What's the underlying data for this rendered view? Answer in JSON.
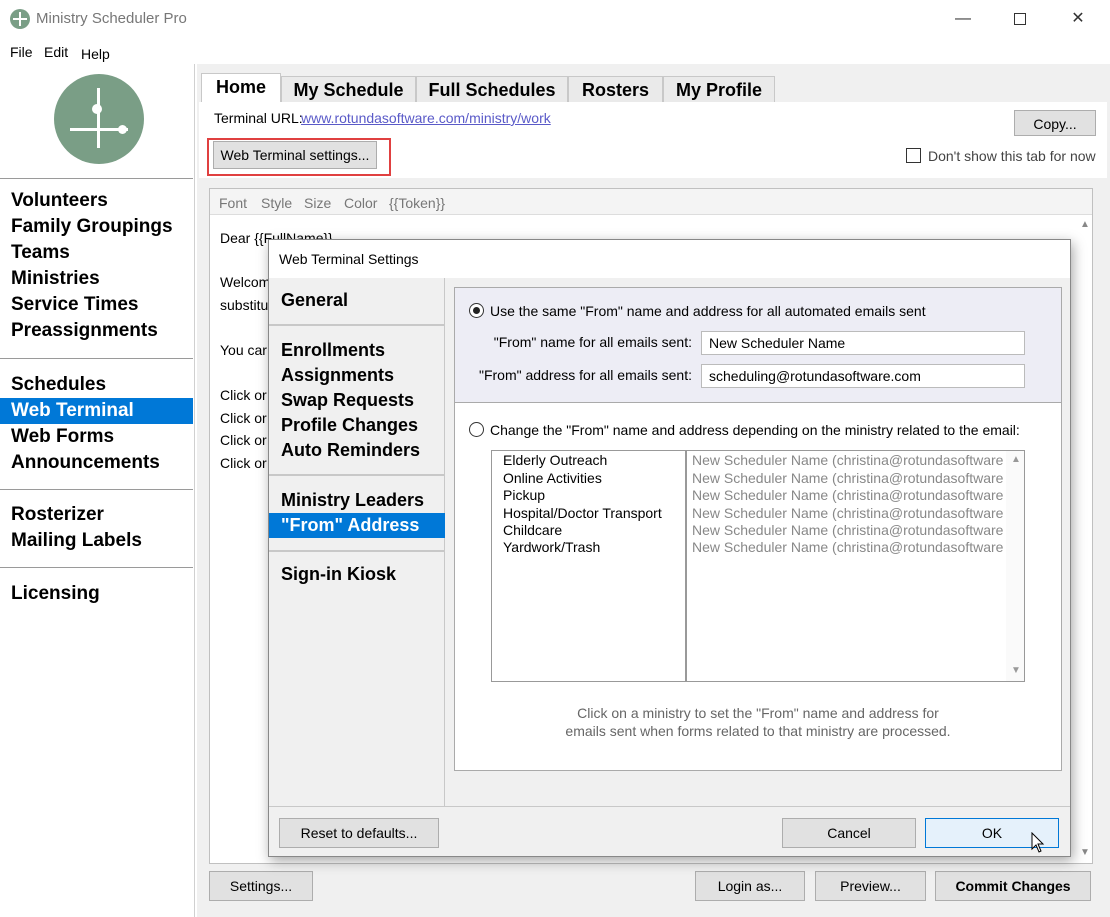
{
  "window": {
    "title": "Ministry Scheduler Pro",
    "minimize_glyph": "—",
    "close_glyph": "✕"
  },
  "menu": [
    "File",
    "Edit",
    "Help"
  ],
  "sidebar": {
    "groups": [
      [
        "Volunteers",
        "Family Groupings",
        "Teams",
        "Ministries",
        "Service Times",
        "Preassignments"
      ],
      [
        "Schedules",
        "Web Terminal",
        "Web Forms",
        "Announcements"
      ],
      [
        "Rosterizer",
        "Mailing Labels"
      ],
      [
        "Licensing"
      ]
    ],
    "active": "Web Terminal"
  },
  "tabs": [
    "Home",
    "My Schedule",
    "Full Schedules",
    "Rosters",
    "My Profile"
  ],
  "home": {
    "terminal_url_label": "Terminal URL:",
    "terminal_url": "www.rotundasoftware.com/ministry/work",
    "copy_button": "Copy...",
    "web_terminal_settings_button": "Web Terminal settings...",
    "dont_show_label": "Don't show this tab for now",
    "dont_show_checked": false
  },
  "editor": {
    "toolbar": [
      "Font",
      "Style",
      "Size",
      "Color",
      "{{Token}}"
    ],
    "lines": [
      "Dear {{FullName}},",
      "Welcom",
      "substitu",
      "You car",
      "Click or",
      "Click or",
      "Click or",
      "Click or"
    ]
  },
  "bottom_buttons": {
    "settings": "Settings...",
    "login_as": "Login as...",
    "preview": "Preview...",
    "commit": "Commit Changes"
  },
  "dialog": {
    "title": "Web Terminal Settings",
    "nav_groups": [
      [
        "General"
      ],
      [
        "Enrollments",
        "Assignments",
        "Swap Requests",
        "Profile Changes",
        "Auto Reminders"
      ],
      [
        "Ministry Leaders",
        "\"From\" Address"
      ],
      [
        "Sign-in Kiosk"
      ]
    ],
    "active_nav": "\"From\" Address",
    "option_same": {
      "label": "Use the same \"From\" name and address for all automated emails sent",
      "selected": true,
      "name_label": "\"From\" name for all emails sent:",
      "name_value": "New Scheduler Name",
      "address_label": "\"From\" address for all emails sent:",
      "address_value": "scheduling@rotundasoftware.com"
    },
    "option_per_ministry": {
      "label": "Change the \"From\" name and address depending on the ministry related to the email:",
      "selected": false
    },
    "ministries": [
      {
        "name": "Elderly Outreach",
        "from": "New Scheduler Name (christina@rotundasoftware.c"
      },
      {
        "name": "Online Activities",
        "from": "New Scheduler Name (christina@rotundasoftware.c"
      },
      {
        "name": "Pickup",
        "from": "New Scheduler Name (christina@rotundasoftware.c"
      },
      {
        "name": "Hospital/Doctor Transport",
        "from": "New Scheduler Name (christina@rotundasoftware.c"
      },
      {
        "name": "Childcare",
        "from": "New Scheduler Name (christina@rotundasoftware.c"
      },
      {
        "name": "Yardwork/Trash",
        "from": "New Scheduler Name (christina@rotundasoftware.c"
      }
    ],
    "help_line1": "Click on a ministry to set the \"From\" name and address for",
    "help_line2": "emails sent when forms related to that ministry are processed.",
    "reset_button": "Reset to defaults...",
    "cancel_button": "Cancel",
    "ok_button": "OK"
  },
  "colors": {
    "accent": "#0078d7",
    "logo": "#7a9e86",
    "highlight": "#e04040",
    "link": "#5a5ac8"
  }
}
